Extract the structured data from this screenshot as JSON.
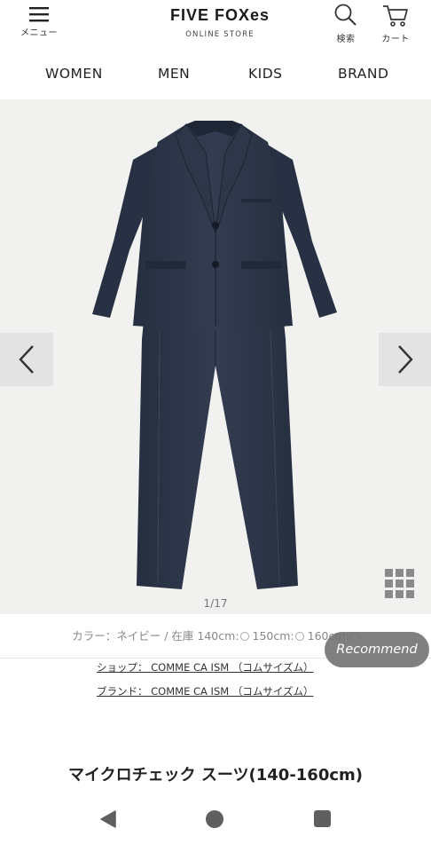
{
  "header": {
    "menu_label": "メニュー",
    "logo_title": "FIVE FOXes",
    "logo_subtitle": "ONLINE STORE",
    "search_label": "検索",
    "cart_label": "カート"
  },
  "nav": {
    "items": [
      {
        "label": "WOMEN"
      },
      {
        "label": "MEN"
      },
      {
        "label": "KIDS"
      },
      {
        "label": "BRAND"
      }
    ]
  },
  "gallery": {
    "counter": "1/17",
    "image_index": 1,
    "image_total": 17
  },
  "product": {
    "stock_prefix": "カラー：ネイビー / 在庫",
    "sizes": [
      {
        "label": "140cm:"
      },
      {
        "label": "150cm:"
      },
      {
        "label": "160cm:"
      }
    ],
    "shop_line": "ショップ： COMME CA ISM （コムサイズム）",
    "brand_line": "ブランド： COMME CA ISM （コムサイズム）",
    "title": "マイクロチェック スーツ(140-160cm)"
  },
  "recommend_label": "Recommend",
  "colors": {
    "suit": "#2b3446",
    "gallery_bg": "#f1f1ef",
    "recommend_bg": "#6e6e6e"
  }
}
